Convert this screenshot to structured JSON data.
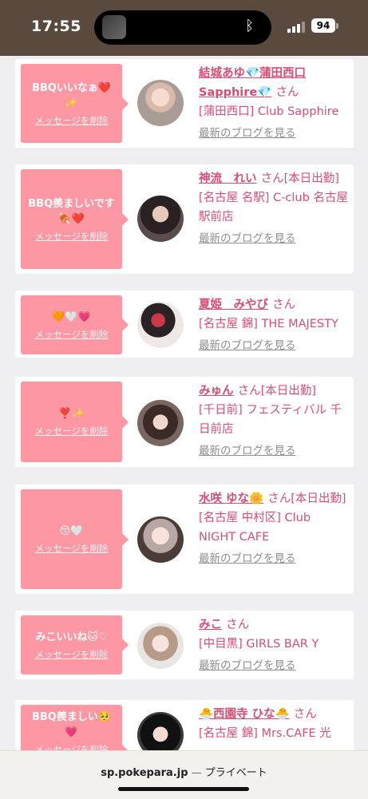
{
  "status": {
    "time": "17:55",
    "battery": "94"
  },
  "colors": {
    "accent": "#d94d73",
    "message_bg": "#fd97a4",
    "statusbar": "#5a4a3e"
  },
  "delete_label": "メッセージを削除",
  "blog_label": "最新のブログを見る",
  "entries": [
    {
      "message": "BBQいいなぁ❤️✨",
      "name": "結城あゆ💎蒲田西口Sapphire💎",
      "san": "さん",
      "shop": "[蒲田西口] Club Sapphire"
    },
    {
      "message": "BBQ羨ましいです🍖❤️",
      "name": "神流　れい",
      "san": "さん[本日出勤]",
      "shop": "[名古屋 名駅] C-club 名古屋駅前店"
    },
    {
      "message": "🧡🤍💗",
      "name": "夏姫　みやび",
      "san": "さん",
      "shop": "[名古屋 錦] THE MAJESTY"
    },
    {
      "message": "❣️✨",
      "name": "みゅん",
      "san": "さん[本日出勤]",
      "shop": "[千日前] フェスティバル 千日前店"
    },
    {
      "message": "😚🤍",
      "name": "水咲 ゆな🌼",
      "san": "さん[本日出勤]",
      "shop": "[名古屋 中村区] Club NIGHT CAFE"
    },
    {
      "message": "みこいいね🐱♡",
      "name": "みこ",
      "san": "さん",
      "shop": "[中目黒] GIRLS BAR Y"
    },
    {
      "message": "BBQ羨ましい🥺💗",
      "name": "🐣西園寺 ひな🐣",
      "san": "さん",
      "shop": "[名古屋 錦] Mrs.CAFE 光"
    }
  ],
  "urlbar": {
    "domain": "sp.pokepara.jp",
    "separator": " — ",
    "mode": "プライベート"
  }
}
